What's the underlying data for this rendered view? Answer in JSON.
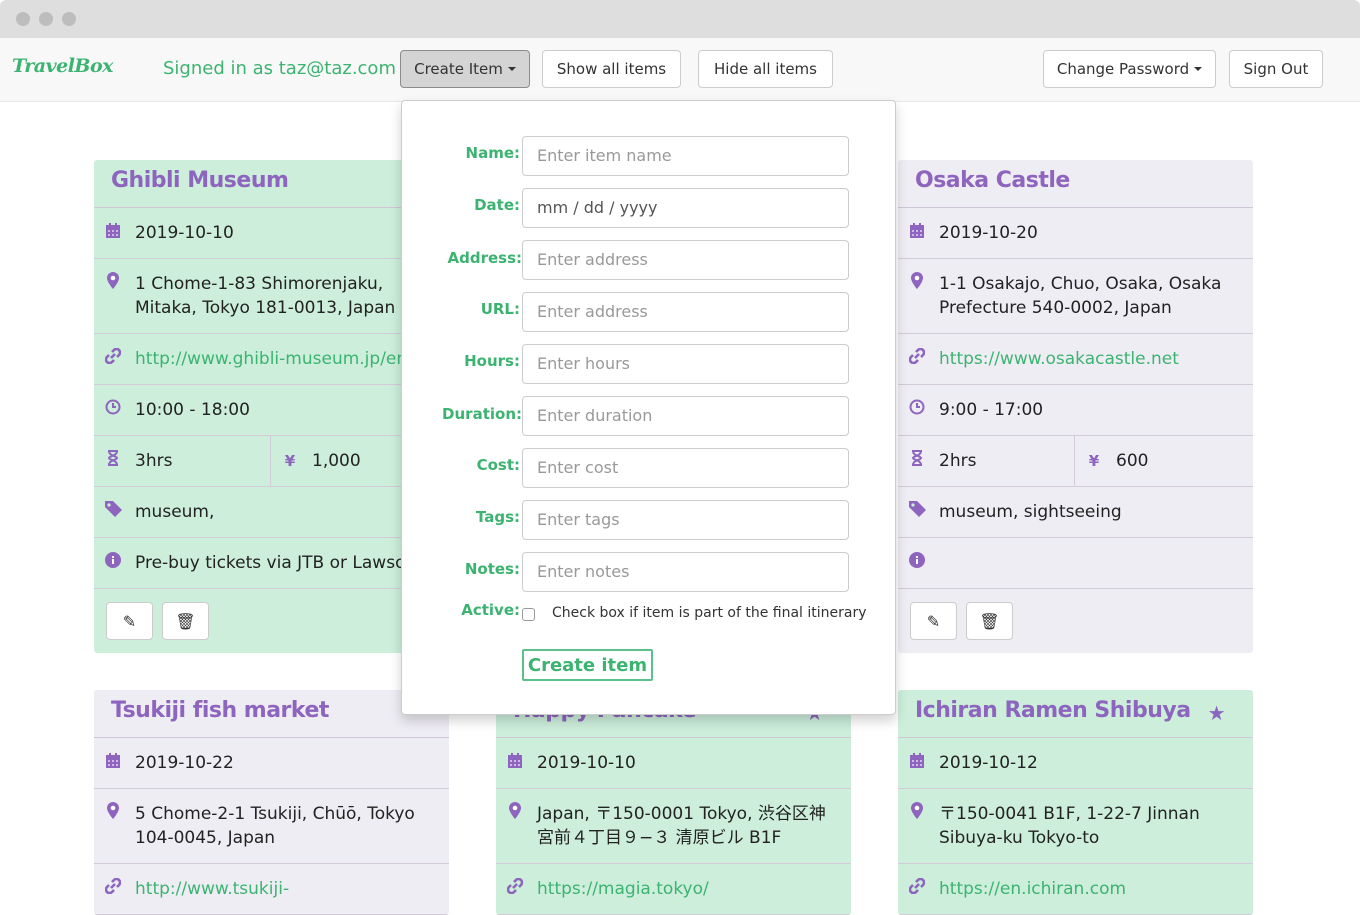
{
  "nav": {
    "brand": "TravelBox",
    "signed_in": "Signed in as taz@taz.com",
    "create_item": "Create Item",
    "show_all": "Show all items",
    "hide_all": "Hide all items",
    "change_password": "Change Password",
    "sign_out": "Sign Out"
  },
  "form": {
    "fields": [
      {
        "label": "Name:",
        "placeholder": "Enter item name"
      },
      {
        "label": "Date:",
        "placeholder": "mm / dd / yyyy"
      },
      {
        "label": "Address:",
        "placeholder": "Enter address"
      },
      {
        "label": "URL:",
        "placeholder": "Enter address"
      },
      {
        "label": "Hours:",
        "placeholder": "Enter hours"
      },
      {
        "label": "Duration:",
        "placeholder": "Enter duration"
      },
      {
        "label": "Cost:",
        "placeholder": "Enter cost"
      },
      {
        "label": "Tags:",
        "placeholder": "Enter tags"
      },
      {
        "label": "Notes:",
        "placeholder": "Enter notes"
      }
    ],
    "active_label": "Active:",
    "active_hint": "Check box if item is part of the final itinerary",
    "active_checked": false,
    "submit": "Create item"
  },
  "colors": {
    "accent_green": "#3cb371",
    "title_purple": "#8e65be",
    "active_card": "#cdeedb",
    "inactive_card": "#efedf4"
  },
  "cards": [
    {
      "name": "Ghibli Museum",
      "active": true,
      "star": false,
      "date": "2019-10-10",
      "address": [
        "1 Chome-1-83 Shimorenjaku,",
        "Mitaka, Tokyo 181-0013, Japan"
      ],
      "url": "http://www.ghibli-museum.jp/en/",
      "hours": "10:00 - 18:00",
      "duration": "3hrs",
      "cost": "1,000",
      "tags": "museum,",
      "notes": "Pre-buy tickets via JTB or Lawson"
    },
    {
      "name": "Osaka Castle",
      "active": false,
      "star": false,
      "date": "2019-10-20",
      "address": [
        "1-1 Osakajo, Chuo, Osaka, Osaka",
        "Prefecture 540-0002, Japan"
      ],
      "url": "https://www.osakacastle.net",
      "hours": "9:00 - 17:00",
      "duration": "2hrs",
      "cost": "600",
      "tags": "museum, sightseeing",
      "notes": ""
    },
    {
      "name": "Tsukiji fish market",
      "active": false,
      "star": false,
      "date": "2019-10-22",
      "address": [
        "5 Chome-2-1 Tsukiji, Chūō, Tokyo",
        "104-0045, Japan"
      ],
      "url": "http://www.tsukiji-"
    },
    {
      "name": "Happy Pancake",
      "active": true,
      "star": true,
      "date": "2019-10-10",
      "address": [
        "Japan, 〒150-0001 Tokyo, 渋谷区神",
        "宮前４丁目９−３ 清原ビル B1F"
      ],
      "url": "https://magia.tokyo/"
    },
    {
      "name": "Ichiran Ramen Shibuya",
      "active": true,
      "star": true,
      "date": "2019-10-12",
      "address": [
        "〒150-0041 B1F, 1-22-7 Jinnan",
        "Sibuya-ku Tokyo-to"
      ],
      "url": "https://en.ichiran.com"
    }
  ]
}
